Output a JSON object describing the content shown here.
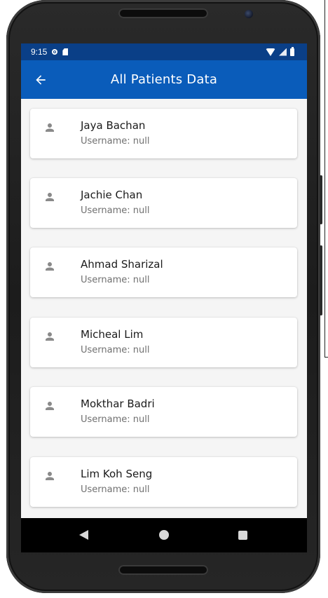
{
  "status_bar": {
    "time": "9:15"
  },
  "app_bar": {
    "title": "All Patients Data"
  },
  "patients": [
    {
      "name": "Jaya Bachan",
      "username": "Username: null"
    },
    {
      "name": "Jachie Chan",
      "username": "Username: null"
    },
    {
      "name": "Ahmad Sharizal",
      "username": "Username: null"
    },
    {
      "name": "Micheal Lim",
      "username": "Username: null"
    },
    {
      "name": "Mokthar Badri",
      "username": "Username: null"
    },
    {
      "name": "Lim Koh Seng",
      "username": "Username: null"
    }
  ],
  "colors": {
    "status_bar": "#0a3f87",
    "app_bar": "#0a5cba",
    "background": "#f5f5f5",
    "icon": "#8a8a8a"
  },
  "icons": {
    "back": "arrow-left-icon",
    "avatar": "person-icon",
    "nav_back": "triangle-back-icon",
    "nav_home": "circle-home-icon",
    "nav_recent": "square-recent-icon"
  }
}
